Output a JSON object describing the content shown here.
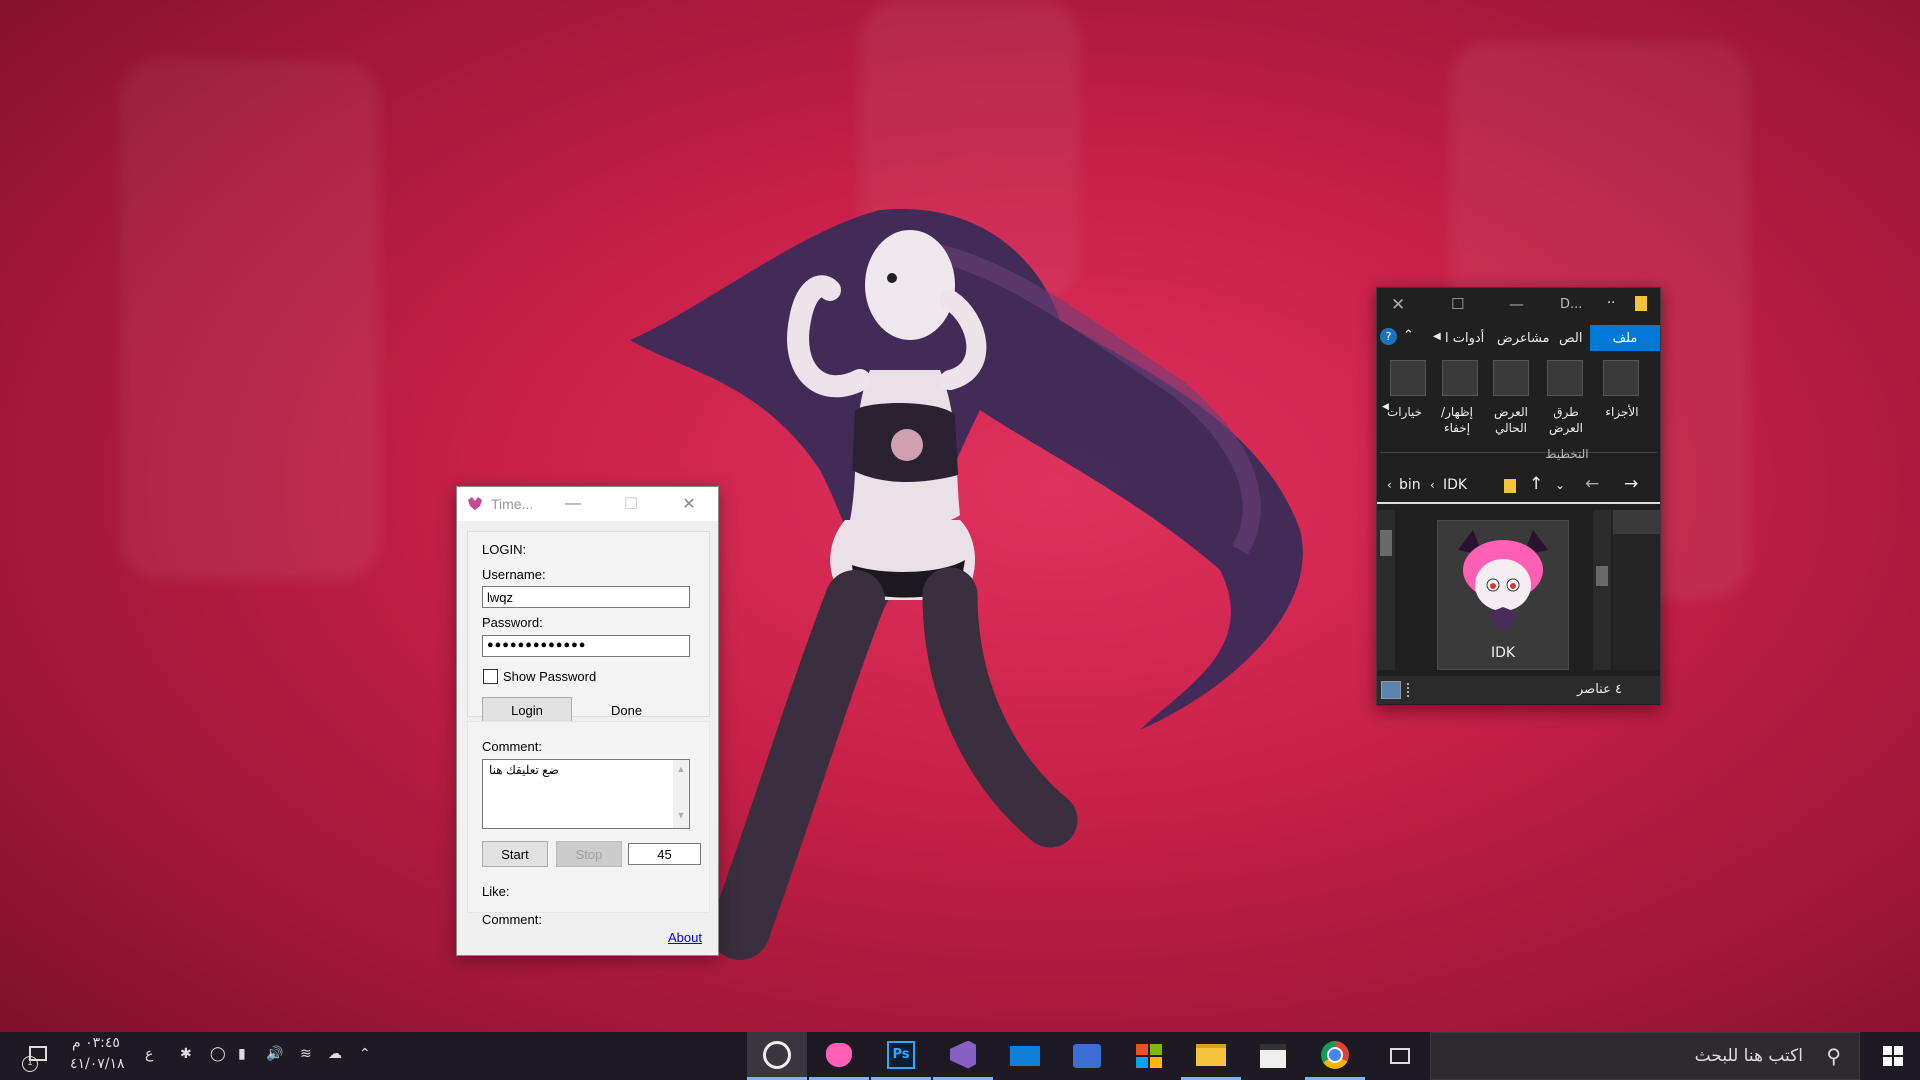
{
  "timer_app": {
    "title": "Time...",
    "login_group_label": "LOGIN:",
    "username_label": "Username:",
    "username_value": "lwqz",
    "password_label": "Password:",
    "password_value": "●●●●●●●●●●●●●",
    "show_password_label": "Show Password",
    "login_button": "Login",
    "done_label": "Done",
    "comment_label": "Comment:",
    "comment_placeholder": "ضع تعليقك هنا",
    "start_button": "Start",
    "stop_button": "Stop",
    "interval_value": "45",
    "like_label": "Like:",
    "comment_status_label": "Comment:",
    "about_link": "About"
  },
  "explorer": {
    "title": "D...",
    "ribbon_tabs": [
      "ملف",
      "الص",
      "مشا",
      "عرض",
      "أدوات ا"
    ],
    "ribbon_buttons": [
      {
        "label": "الأجزاء"
      },
      {
        "label": "طرق العرض"
      },
      {
        "label": "العرض الحالي"
      },
      {
        "label": "إظهار/ إخفاء"
      },
      {
        "label": "خيارات"
      }
    ],
    "ribbon_group": "التخطيط",
    "breadcrumb": [
      "IDK",
      "bin"
    ],
    "item_name": "IDK",
    "status": "٤ عناصر"
  },
  "taskbar": {
    "search_placeholder": "اكتب هنا للبحث",
    "time": "٠٣:٤٥ م",
    "date": "٤١/٠٧/١٨",
    "lang": "ع",
    "notification_count": "1"
  },
  "colors": {
    "desktop": "#c9214a",
    "explorer_accent": "#0078d7",
    "taskbar": "#1e1a24"
  }
}
